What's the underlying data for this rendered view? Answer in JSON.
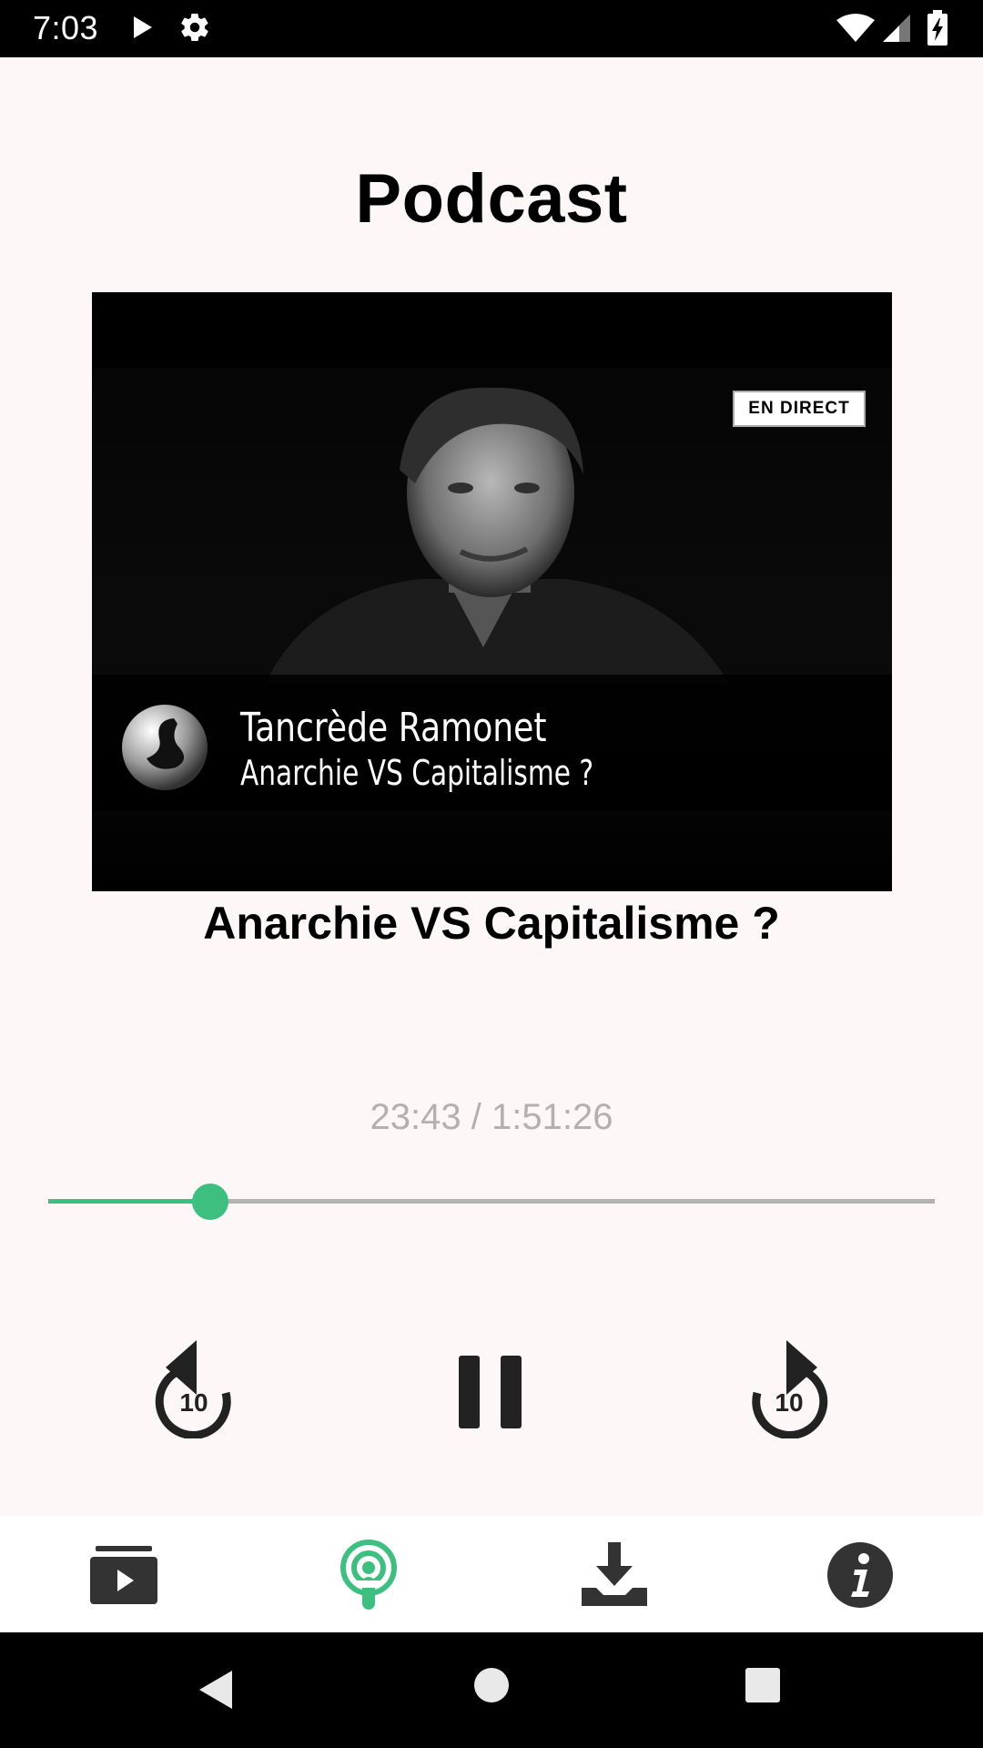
{
  "status_bar": {
    "time": "7:03",
    "icons": [
      "play-icon",
      "gear-icon",
      "wifi-icon",
      "signal-icon",
      "battery-charging-icon"
    ]
  },
  "header": {
    "title": "Podcast"
  },
  "artwork": {
    "badge": "EN DIRECT",
    "name": "Tancrède Ramonet",
    "subtitle": "Anarchie VS Capitalisme ?"
  },
  "episode": {
    "title": "Anarchie VS Capitalisme ?"
  },
  "player": {
    "time": "23:43 / 1:51:26",
    "progress": 0.1828,
    "rewind_label": "10",
    "forward_label": "10",
    "accent": "#3dbf7f"
  },
  "bottom_nav": {
    "items": [
      {
        "icon": "video-library-icon",
        "active": false
      },
      {
        "icon": "podcast-icon",
        "active": true
      },
      {
        "icon": "download-icon",
        "active": false
      },
      {
        "icon": "info-icon",
        "active": false
      }
    ]
  }
}
